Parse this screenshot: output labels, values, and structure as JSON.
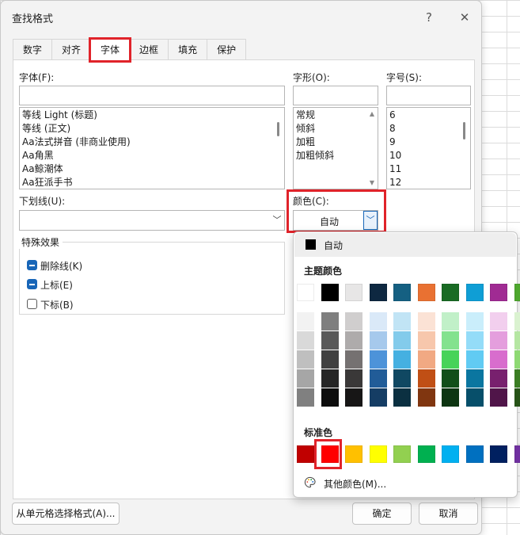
{
  "dialog": {
    "title": "查找格式",
    "help": "?",
    "close": "✕"
  },
  "tabs": [
    "数字",
    "对齐",
    "字体",
    "边框",
    "填充",
    "保护"
  ],
  "font": {
    "label": "字体(F):",
    "items": [
      "等线 Light (标题)",
      "等线 (正文)",
      "Aa法式拼音 (非商业使用)",
      "Aa角黑",
      "Aa鲸潮体",
      "Aa狂派手书"
    ]
  },
  "style": {
    "label": "字形(O):",
    "items": [
      "常规",
      "倾斜",
      "加粗",
      "加粗倾斜"
    ]
  },
  "size": {
    "label": "字号(S):",
    "items": [
      "6",
      "8",
      "9",
      "10",
      "11",
      "12"
    ]
  },
  "underline": {
    "label": "下划线(U):",
    "value": ""
  },
  "color": {
    "label": "颜色(C):",
    "value": "自动"
  },
  "effects": {
    "title": "特殊效果",
    "items": [
      "删除线(K)",
      "上标(E)",
      "下标(B)"
    ],
    "states": [
      "indeterminate",
      "indeterminate",
      "unchecked"
    ]
  },
  "buttons": {
    "pick_from_cell": "从单元格选择格式(A)...",
    "ok": "确定",
    "cancel": "取消"
  },
  "palette": {
    "auto": "自动",
    "theme_title": "主题颜色",
    "standard_title": "标准色",
    "more": "其他颜色(M)...",
    "theme_top": [
      "#ffffff",
      "#000000",
      "#e7e6e6",
      "#0e2841",
      "#156082",
      "#e97132",
      "#196b24",
      "#0f9ed5",
      "#a02b93",
      "#4ea72e"
    ],
    "theme_shades": [
      [
        "#f2f2f2",
        "#7f7f7f",
        "#d0cece",
        "#dae9f8",
        "#c1e4f5",
        "#fbe2d5",
        "#c1f0c8",
        "#caeefb",
        "#f2cfee",
        "#daf2d0"
      ],
      [
        "#d9d9d9",
        "#595959",
        "#aeabab",
        "#a6c9ec",
        "#83cbeb",
        "#f7c7ac",
        "#83e28e",
        "#94dcf8",
        "#e49edd",
        "#b5e6a2"
      ],
      [
        "#bfbfbf",
        "#404040",
        "#757171",
        "#4d93d9",
        "#45b0e1",
        "#f1a983",
        "#47d359",
        "#61cbf3",
        "#d86dcd",
        "#8ed973"
      ],
      [
        "#a6a6a6",
        "#262626",
        "#3a3838",
        "#215c98",
        "#104862",
        "#c04f15",
        "#124f1a",
        "#0b76a0",
        "#78206e",
        "#3b7d23"
      ],
      [
        "#808080",
        "#0d0d0d",
        "#171616",
        "#153d64",
        "#0b3041",
        "#803610",
        "#0d3512",
        "#074f6a",
        "#501549",
        "#275317"
      ]
    ],
    "standard": [
      "#c00000",
      "#ff0000",
      "#ffc000",
      "#ffff00",
      "#92d050",
      "#00b050",
      "#00b0f0",
      "#0070c0",
      "#002060",
      "#7030a0"
    ]
  }
}
